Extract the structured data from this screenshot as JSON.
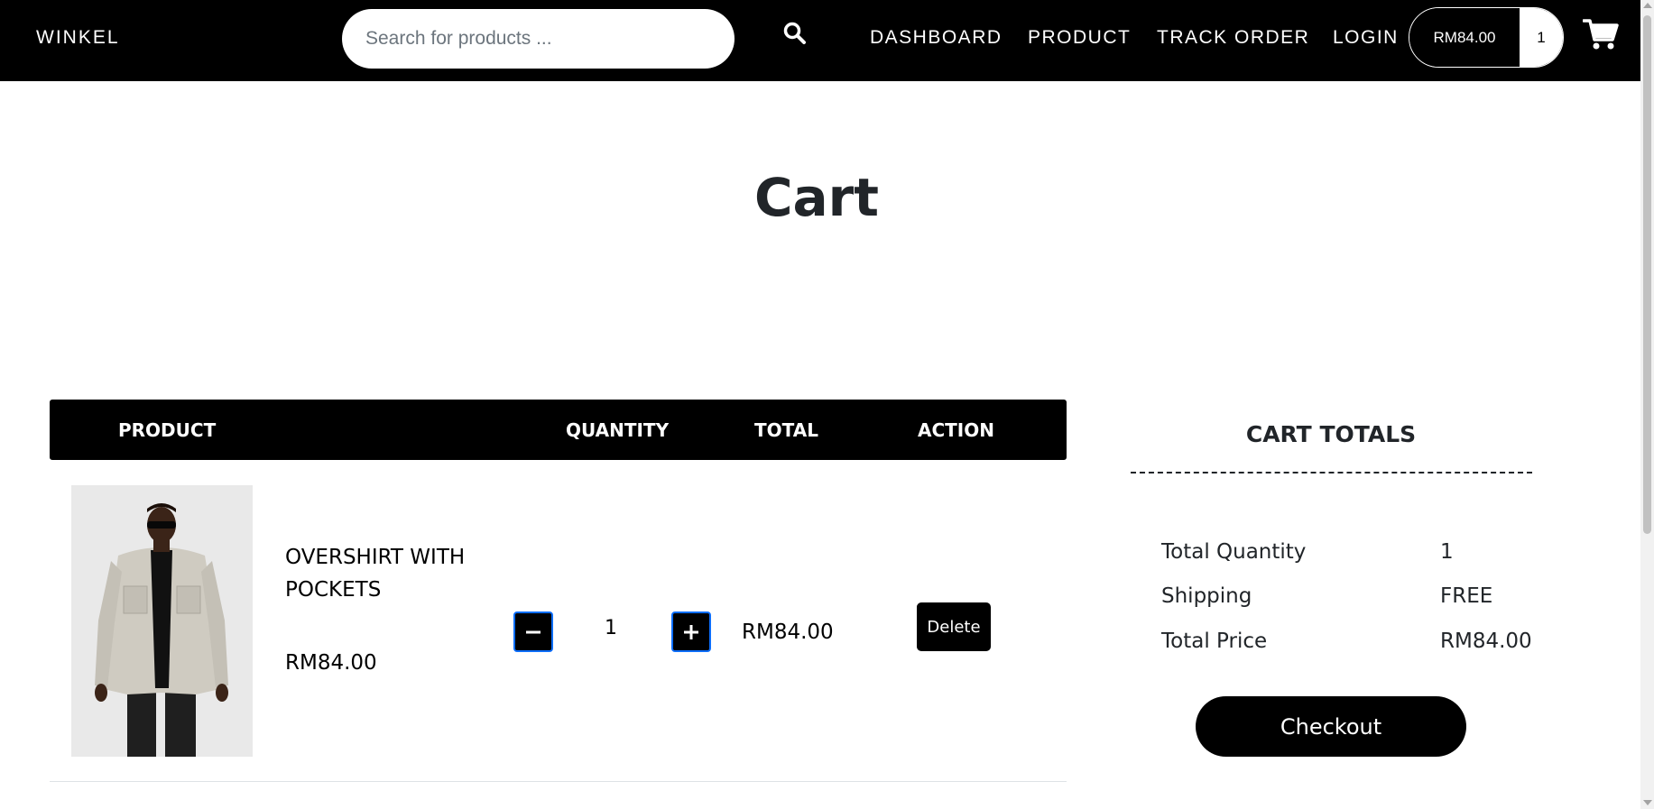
{
  "header": {
    "brand": "WINKEL",
    "search_placeholder": "Search for products ...",
    "nav": {
      "dashboard": "DASHBOARD",
      "product": "PRODUCT",
      "track_order": "TRACK ORDER",
      "login": "LOGIN"
    },
    "cart_amount": "RM84.00",
    "cart_count": "1"
  },
  "page": {
    "title": "Cart"
  },
  "table": {
    "headers": {
      "product": "PRODUCT",
      "quantity": "QUANTITY",
      "total": "TOTAL",
      "action": "ACTION"
    },
    "rows": [
      {
        "name": "OVERSHIRT WITH POCKETS",
        "price": "RM84.00",
        "quantity": "1",
        "total": "RM84.00",
        "delete_label": "Delete"
      }
    ]
  },
  "totals": {
    "title": "CART TOTALS",
    "total_quantity_label": "Total Quantity",
    "total_quantity_value": "1",
    "shipping_label": "Shipping",
    "shipping_value": "FREE",
    "total_price_label": "Total Price",
    "total_price_value": "RM84.00",
    "checkout_label": "Checkout"
  },
  "icons": {
    "search": "search-icon",
    "cart": "shopping-cart-icon",
    "minus": "minus-icon",
    "plus": "plus-icon"
  },
  "colors": {
    "header_bg": "#000000",
    "qty_btn_border": "#0d6efd"
  }
}
